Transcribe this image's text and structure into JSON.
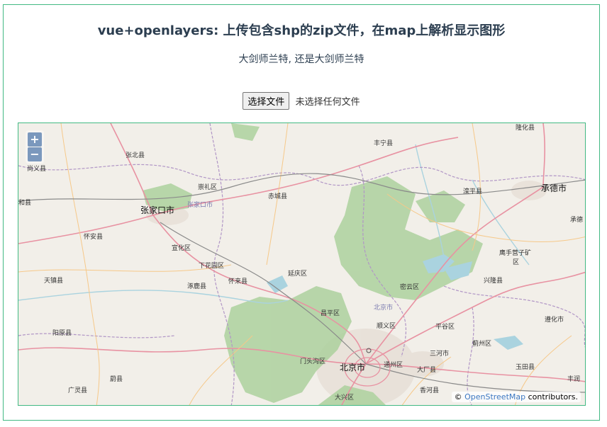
{
  "header": {
    "title": "vue+openlayers: 上传包含shp的zip文件，在map上解析显示图形",
    "subtitle": "大剑师兰特, 还是大剑师兰特"
  },
  "upload": {
    "button_label": "选择文件",
    "status": "未选择任何文件"
  },
  "map": {
    "zoom_in": "+",
    "zoom_out": "−",
    "attribution_prefix": "©",
    "attribution_link": "OpenStreetMap",
    "attribution_suffix": "contributors.",
    "places": {
      "longhua": "隆化县",
      "zhangbei": "张北县",
      "shangyi": "尚义县",
      "fengning": "丰宁县",
      "chongli": "崇礼区",
      "chicheng": "赤城县",
      "luanping": "滦平县",
      "chengde": "承德市",
      "chengde2": "承德",
      "zhangjiakou": "张家口市",
      "zhangjiakou_faint": "张家口市",
      "he": "和县",
      "huaian": "怀安县",
      "xuanhua": "宣化区",
      "yingshouyingzi": "鹰手营子矿",
      "qu": "区",
      "xiahuayuan": "下花园区",
      "yanqing": "延庆区",
      "tianzhen": "天镇县",
      "zhuolu": "涿鹿县",
      "huailai": "怀来县",
      "miyun": "密云区",
      "xinglong": "兴隆县",
      "changping": "昌平区",
      "beijing_faint": "北京市",
      "shunyi": "顺义区",
      "pinggu": "平谷区",
      "zunhua": "遵化市",
      "yangyuan": "阳原县",
      "jizhou": "蓟州区",
      "sanhe": "三河市",
      "mentougou": "门头沟区",
      "beijing": "北京市",
      "tongzhou": "通州区",
      "dachang": "大厂县",
      "yutian": "玉田县",
      "guangling": "广灵县",
      "yuxian": "蔚县",
      "xianghe": "香河县",
      "fengrun": "丰润",
      "daxing": "大兴区"
    }
  }
}
